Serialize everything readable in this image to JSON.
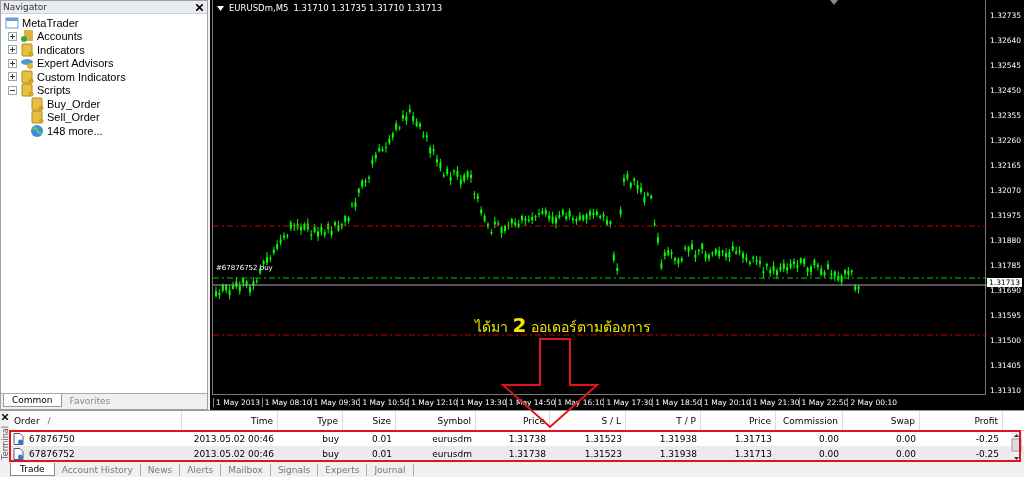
{
  "navigator": {
    "title": "Navigator",
    "tree": [
      {
        "label": "MetaTrader",
        "kind": "terminal",
        "children": [
          {
            "label": "Accounts",
            "kind": "accounts",
            "expanded": false
          },
          {
            "label": "Indicators",
            "kind": "indicators",
            "expanded": false
          },
          {
            "label": "Expert Advisors",
            "kind": "experts",
            "expanded": false
          },
          {
            "label": "Custom Indicators",
            "kind": "custom",
            "expanded": false
          },
          {
            "label": "Scripts",
            "kind": "scripts",
            "expanded": true,
            "children": [
              {
                "label": "Buy_Order",
                "kind": "script"
              },
              {
                "label": "Sell_Order",
                "kind": "script"
              },
              {
                "label": "148 more...",
                "kind": "more"
              }
            ]
          }
        ]
      }
    ],
    "tabs": [
      {
        "label": "Common",
        "selected": true
      },
      {
        "label": "Favorites",
        "selected": false
      }
    ]
  },
  "chart": {
    "symbol": "EURUSDm,M5",
    "quotes": "1.31710 1.31735 1.31710 1.31713",
    "order_label": "#67876752 buy",
    "current_price": "1.31713",
    "price_axis": [
      "1.32735",
      "1.32640",
      "1.32545",
      "1.32450",
      "1.32355",
      "1.32260",
      "1.32165",
      "1.32070",
      "1.31975",
      "1.31880",
      "1.31785",
      "1.31690",
      "1.31595",
      "1.31500",
      "1.31405",
      "1.31310"
    ],
    "time_axis": [
      "1 May 2013",
      "1 May 08:10",
      "1 May 09:30",
      "1 May 10:50",
      "1 May 12:10",
      "1 May 13:30",
      "1 May 14:50",
      "1 May 16:10",
      "1 May 17:30",
      "1 May 18:50",
      "1 May 20:10",
      "1 May 21:30",
      "1 May 22:50",
      "2 May 00:10"
    ],
    "annotation": "ได้มา **2** ออเดอร์ตามต้องการ"
  },
  "terminal": {
    "title": "Terminal",
    "sort_indicator": "/",
    "columns": [
      "Order",
      "Time",
      "Type",
      "Size",
      "Symbol",
      "Price",
      "S / L",
      "T / P",
      "Price",
      "Commission",
      "Swap",
      "Profit"
    ],
    "rows": [
      [
        "67876750",
        "2013.05.02 00:46",
        "buy",
        "0.01",
        "eurusdm",
        "1.31738",
        "1.31523",
        "1.31938",
        "1.31713",
        "0.00",
        "0.00",
        "-0.25"
      ],
      [
        "67876752",
        "2013.05.02 00:46",
        "buy",
        "0.01",
        "eurusdm",
        "1.31738",
        "1.31523",
        "1.31938",
        "1.31713",
        "0.00",
        "0.00",
        "-0.25"
      ]
    ],
    "tabs": [
      {
        "label": "Trade",
        "selected": true
      },
      {
        "label": "Account History",
        "selected": false
      },
      {
        "label": "News",
        "selected": false
      },
      {
        "label": "Alerts",
        "selected": false
      },
      {
        "label": "Mailbox",
        "selected": false
      },
      {
        "label": "Signals",
        "selected": false
      },
      {
        "label": "Experts",
        "selected": false
      },
      {
        "label": "Journal",
        "selected": false
      }
    ]
  }
}
